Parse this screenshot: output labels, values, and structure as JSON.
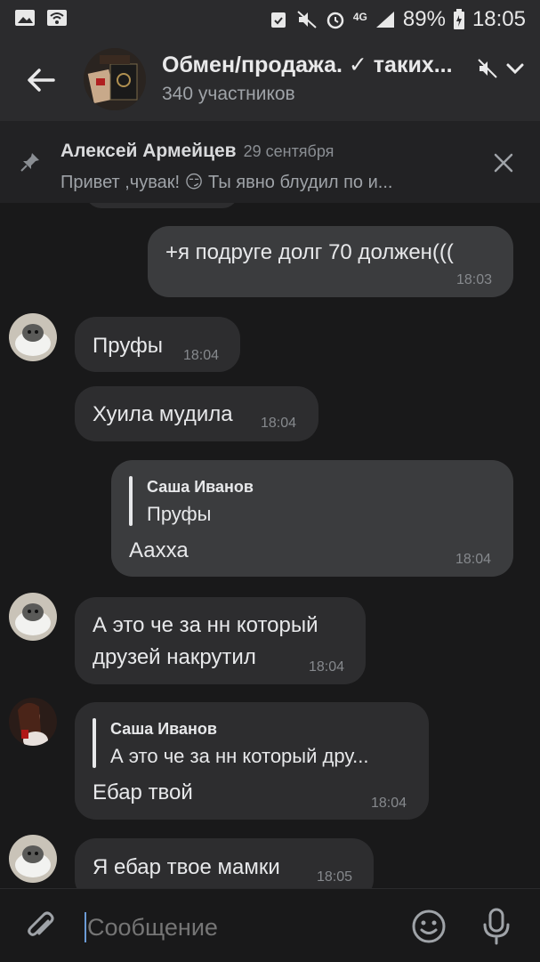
{
  "status_bar": {
    "network": "4G",
    "battery": "89%",
    "time": "18:05"
  },
  "header": {
    "title": "Обмен/продажа. ✓ таких...",
    "subtitle": "340 участников"
  },
  "pinned": {
    "author": "Алексей Армейцев",
    "date": "29 сентября",
    "text": "Привет ,чувак! 😏 Ты явно блудил по и..."
  },
  "messages": [
    {
      "text": "+я подруге долг 70 должен(((",
      "time": "18:03"
    },
    {
      "text": "Пруфы",
      "time": "18:04"
    },
    {
      "text": "Хуила мудила",
      "time": "18:04"
    },
    {
      "quote_author": "Саша Иванов",
      "quote_text": "Пруфы",
      "text": "Аахха",
      "time": "18:04"
    },
    {
      "text_line1": "А это че за нн который",
      "text_line2": "друзей накрутил",
      "time": "18:04"
    },
    {
      "quote_author": "Саша Иванов",
      "quote_text": "А это че за нн который дру...",
      "text": "Ебар твой",
      "time": "18:04"
    },
    {
      "text": "Я ебар твое мамки",
      "time": "18:05"
    }
  ],
  "composer": {
    "placeholder": "Сообщение"
  },
  "icons": {
    "back": "arrow-left-icon",
    "mute": "mute-icon",
    "pin": "pin-icon",
    "close": "close-icon",
    "attach": "paperclip-icon",
    "emoji": "emoji-icon",
    "mic": "microphone-icon"
  }
}
